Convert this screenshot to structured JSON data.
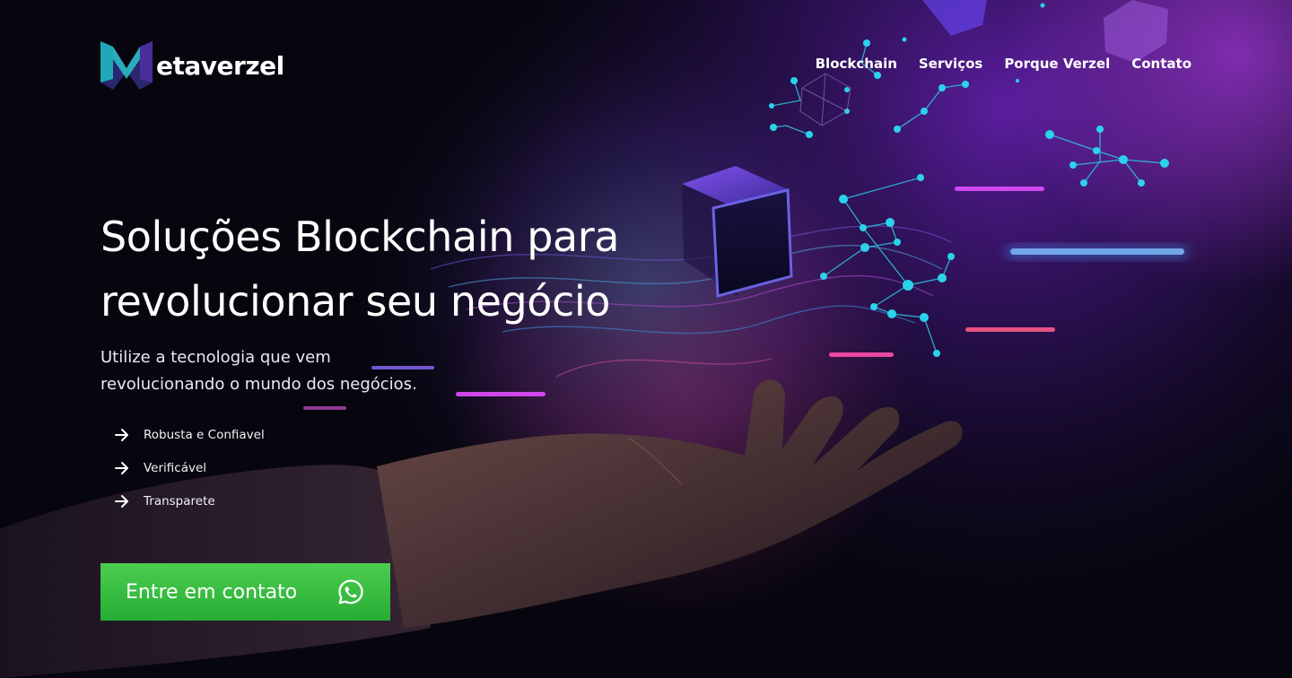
{
  "brand": {
    "logo_text": "etaverzel",
    "logo_icon": "metaverzel-m-logo-icon"
  },
  "nav": {
    "items": [
      "Blockchain",
      "Serviços",
      "Porque Verzel",
      "Contato"
    ]
  },
  "hero": {
    "headline": [
      "Soluções Blockchain para",
      "revolucionar seu negócio"
    ],
    "subtitle": [
      "Utilize a tecnologia que vem",
      "revolucionando o mundo dos negócios."
    ],
    "features": [
      {
        "icon": "arrow-right-icon",
        "label": "Robusta e Confiavel"
      },
      {
        "icon": "arrow-right-icon",
        "label": "Verificável"
      },
      {
        "icon": "arrow-right-icon",
        "label": "Transparete"
      }
    ],
    "cta": {
      "label": "Entre em contato",
      "icon": "whatsapp-icon"
    },
    "background_image": "hand-holding-glowing-blockchain-cube-with-network-nodes"
  },
  "colors": {
    "background": "#07060f",
    "accent_purple": "#6a22b8",
    "accent_cyan": "#2bd3ea",
    "accent_pink": "#e34cff",
    "cta_green": "#33bb3f",
    "logo_teal": "#1fa8b8",
    "logo_indigo": "#4a2f9a"
  }
}
